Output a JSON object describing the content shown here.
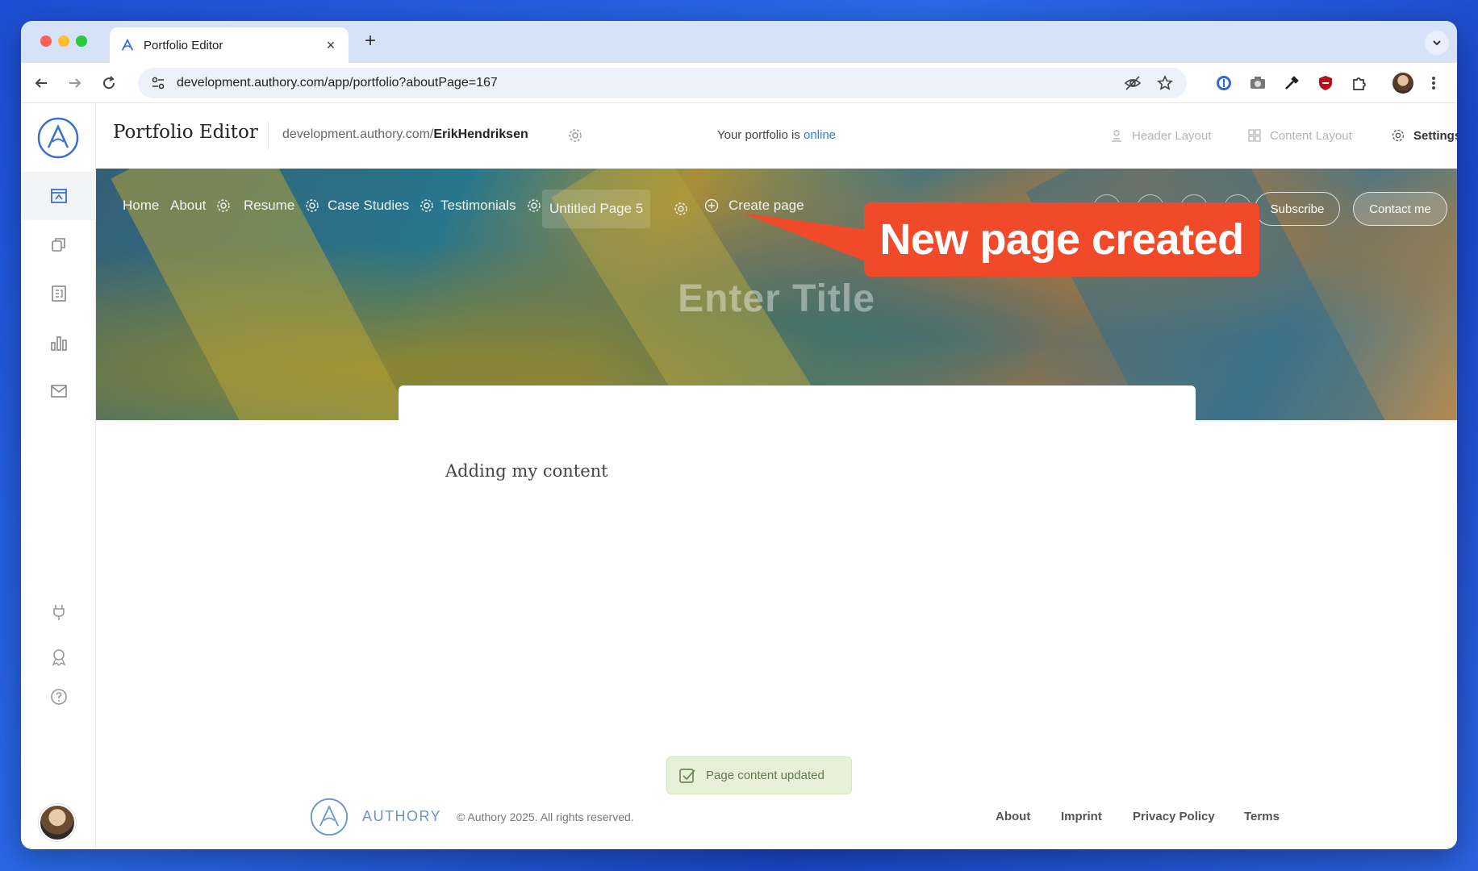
{
  "browser": {
    "tab_title": "Portfolio Editor",
    "tab_close": "×",
    "new_tab": "+",
    "url": "development.authory.com/app/portfolio?aboutPage=167",
    "url_icons": [
      "eye-slash-icon",
      "star-icon"
    ],
    "extensions": [
      "1password-icon",
      "camera-icon",
      "eyedropper-icon",
      "shield-icon",
      "puzzle-icon",
      "profile-avatar",
      "kebab-menu-icon"
    ]
  },
  "sidebar": {
    "items": [
      "portfolio-icon",
      "copy-icon",
      "articles-icon",
      "analytics-icon",
      "mail-icon",
      "plug-icon",
      "award-icon",
      "help-icon"
    ]
  },
  "header": {
    "title": "Portfolio Editor",
    "domain_prefix": "development.authory.com/",
    "domain_user": "ErikHendriksen",
    "status_prefix": "Your portfolio is ",
    "status_value": "online",
    "actions": [
      {
        "label": "Header Layout",
        "icon": "person-layout-icon"
      },
      {
        "label": "Content Layout",
        "icon": "grid-layout-icon"
      },
      {
        "label": "Settings",
        "icon": "gear-icon"
      }
    ]
  },
  "portfolio_nav": {
    "items": [
      {
        "label": "Home",
        "gear": false
      },
      {
        "label": "About",
        "gear": true
      },
      {
        "label": "Resume",
        "gear": true
      },
      {
        "label": "Case Studies",
        "gear": true
      },
      {
        "label": "Testimonials",
        "gear": true
      },
      {
        "label": "Untitled Page 5",
        "gear": true,
        "active": true
      }
    ],
    "create_page": "Create page",
    "subscribe": "Subscribe",
    "contact": "Contact me"
  },
  "hero": {
    "title_placeholder": "Enter Title"
  },
  "content": {
    "text": "Adding my content"
  },
  "toast": {
    "message": "Page content updated"
  },
  "footer": {
    "brand": "AUTHORY",
    "copyright": "© Authory 2025. All rights reserved.",
    "links": [
      "About",
      "Imprint",
      "Privacy Policy",
      "Terms"
    ]
  },
  "callout": {
    "text": "New page created",
    "color": "#f04a2b"
  }
}
